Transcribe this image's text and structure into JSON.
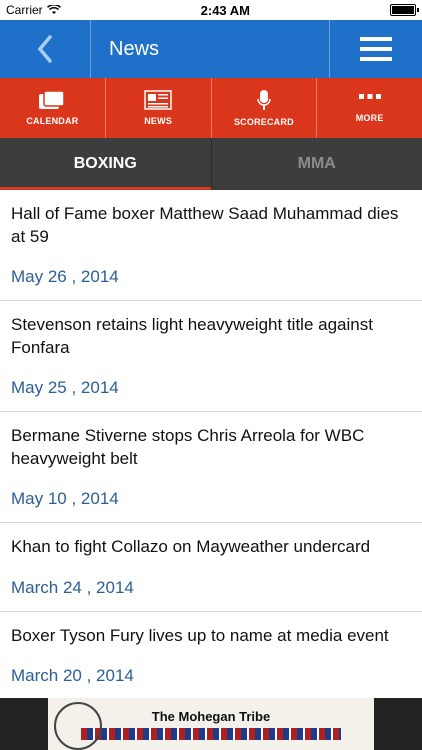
{
  "status_bar": {
    "carrier": "Carrier",
    "time": "2:43 AM"
  },
  "navbar": {
    "title": "News"
  },
  "toolbar": [
    {
      "label": "CALENDAR",
      "icon": "calendar-icon"
    },
    {
      "label": "NEWS",
      "icon": "newspaper-icon"
    },
    {
      "label": "SCORECARD",
      "icon": "microphone-icon"
    },
    {
      "label": "MORE",
      "icon": "more-icon"
    }
  ],
  "tabs": [
    {
      "label": "BOXING",
      "active": true
    },
    {
      "label": "MMA",
      "active": false
    }
  ],
  "news": [
    {
      "headline": "Hall of Fame boxer Matthew Saad Muhammad dies at 59",
      "date": "May 26 , 2014"
    },
    {
      "headline": "Stevenson retains light heavyweight title against Fonfara",
      "date": "May 25 , 2014"
    },
    {
      "headline": "Bermane Stiverne stops Chris Arreola for WBC heavyweight belt",
      "date": "May 10 , 2014"
    },
    {
      "headline": "Khan to fight Collazo on Mayweather undercard",
      "date": "March 24 , 2014"
    },
    {
      "headline": "Boxer Tyson Fury lives up to name at media event",
      "date": "March 20 , 2014"
    }
  ],
  "ad": {
    "text": "The Mohegan Tribe"
  },
  "colors": {
    "nav_blue": "#1f70c8",
    "toolbar_red": "#d9361b",
    "tab_bg": "#3d3d3d",
    "date_blue": "#2b5f97"
  }
}
